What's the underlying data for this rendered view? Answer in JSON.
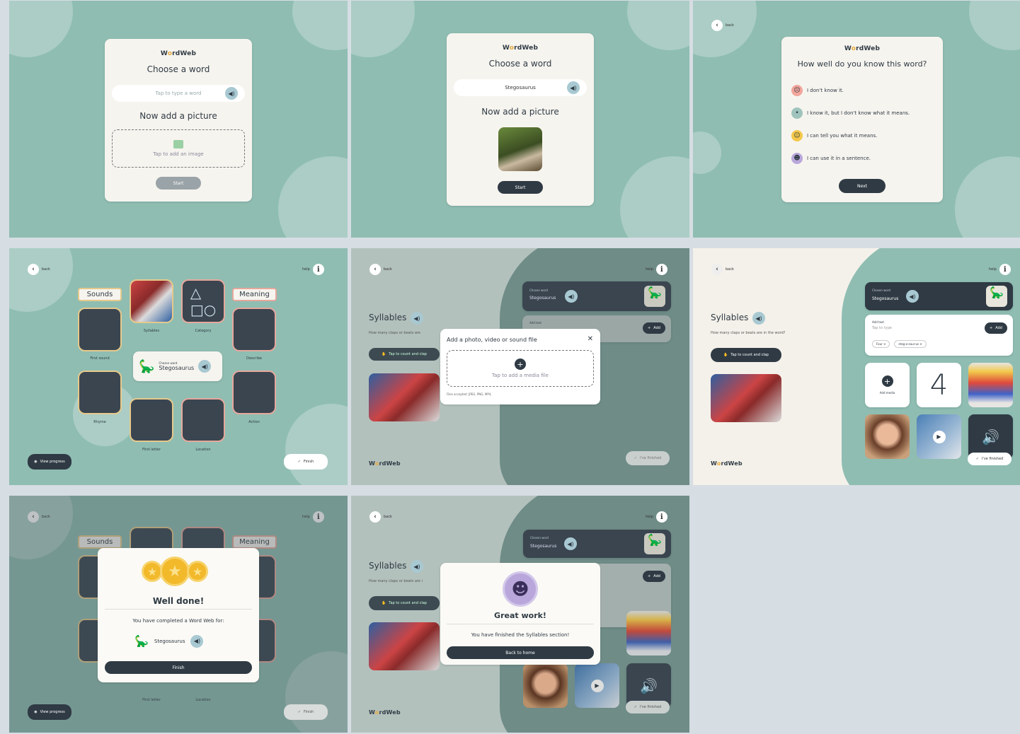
{
  "brand": {
    "logo_pre": "W",
    "logo_o": "o",
    "logo_post": "rdWeb"
  },
  "screen1": {
    "title": "Choose a word",
    "input_placeholder": "Tap to type a word",
    "add_picture": "Now add a picture",
    "image_hint": "Tap to add an image",
    "start": "Start"
  },
  "screen2": {
    "title": "Choose a word",
    "input_value": "Stegosaurus",
    "add_picture": "Now add a picture",
    "start": "Start"
  },
  "screen3": {
    "back": "back",
    "question": "How well do you know this word?",
    "options": [
      "I don't know it.",
      "I know it, but I don't know what it means.",
      "I can tell you what it means.",
      "I can use it in a sentence."
    ],
    "next": "Next"
  },
  "screen4": {
    "back": "back",
    "help": "help",
    "sounds": "Sounds",
    "meaning": "Meaning",
    "tiles": {
      "syllables": "Syllables",
      "category": "Category",
      "first_sound": "First sound",
      "describe": "Describe",
      "rhyme": "Rhyme",
      "action": "Action",
      "first_letter": "First letter",
      "location": "Location"
    },
    "chosen_label": "Chosen word",
    "chosen_word": "Stegosaurus",
    "view_progress": "View progress",
    "finish": "Finish"
  },
  "screen5": {
    "back": "back",
    "help": "help",
    "section": "Syllables",
    "question": "How many claps or beats are",
    "clap_btn": "Tap to count and clap",
    "chosen_label": "Chosen word",
    "chosen_word": "Stegosaurus",
    "add_text": "Add text",
    "add": "Add",
    "modal_title": "Add a photo, video or sound file",
    "modal_hint": "Tap to add a media file",
    "files": "Files accepted: JPEG, PNG, MP4,",
    "finished": "I've finished"
  },
  "screen6": {
    "back": "back",
    "help": "help",
    "section": "Syllables",
    "question": "How many claps or beats are in the word?",
    "clap_btn": "Tap to count and clap",
    "chosen_label": "Chosen word",
    "chosen_word": "Stegosaurus",
    "add_text": "Add text",
    "type_hint": "Tap to type",
    "chips": [
      "Four",
      "steg-o-saur-us"
    ],
    "add": "Add",
    "add_media": "Add media",
    "four": "4",
    "finished": "I've finished"
  },
  "screen7": {
    "back": "back",
    "help": "help",
    "well_done": "Well done!",
    "completed": "You have completed a Word Web for:",
    "word": "Stegosaurus",
    "finish": "Finish",
    "view_progress": "View progress",
    "finish_small": "Finish",
    "sounds": "Sounds",
    "meaning": "Meaning",
    "first_letter": "First letter",
    "location": "Location"
  },
  "screen8": {
    "back": "back",
    "help": "help",
    "section": "Syllables",
    "question": "How many claps or beats are i",
    "clap_btn": "Tap to count and clap",
    "chosen_label": "Chosen word",
    "chosen_word": "Stegosaurus",
    "add": "Add",
    "great": "Great work!",
    "finished_text": "You have finished the Syllables section!",
    "back_home": "Back to home",
    "finished": "I've finished"
  },
  "colors": {
    "teal": "#8fbdb2",
    "dark": "#2f3a44",
    "cream": "#f6f4ef"
  }
}
